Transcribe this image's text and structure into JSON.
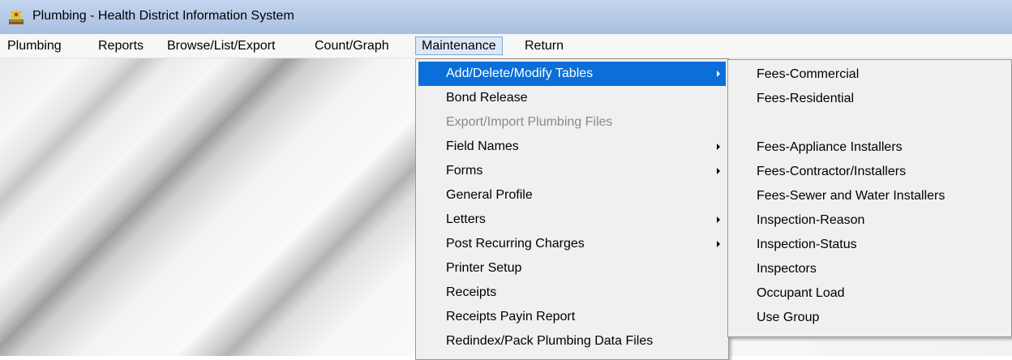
{
  "window": {
    "title": "Plumbing - Health District Information System",
    "icon": "app-flower-icon"
  },
  "menubar": {
    "items": [
      "Plumbing",
      "Reports",
      "Browse/List/Export",
      "Count/Graph",
      "Maintenance",
      "Return"
    ],
    "active": "Maintenance"
  },
  "maintenance_menu": {
    "items": [
      {
        "label": "Add/Delete/Modify Tables",
        "submenu": true,
        "highlighted": true
      },
      {
        "label": "Bond Release"
      },
      {
        "label": "Export/Import Plumbing Files",
        "disabled": true
      },
      {
        "label": "Field Names",
        "submenu": true
      },
      {
        "label": "Forms",
        "submenu": true
      },
      {
        "label": "General Profile"
      },
      {
        "label": "Letters",
        "submenu": true
      },
      {
        "label": "Post Recurring Charges",
        "submenu": true
      },
      {
        "label": "Printer Setup"
      },
      {
        "label": "Receipts"
      },
      {
        "label": "Receipts Payin Report"
      },
      {
        "label": "Redindex/Pack Plumbing Data Files"
      }
    ]
  },
  "tables_submenu": {
    "items": [
      "Fees-Commercial",
      "Fees-Residential",
      "",
      "Fees-Appliance Installers",
      "Fees-Contractor/Installers",
      "Fees-Sewer and Water Installers",
      "Inspection-Reason",
      "Inspection-Status",
      "Inspectors",
      "Occupant Load",
      "Use Group"
    ]
  },
  "colors": {
    "titlebar": "#b4c8e6",
    "menubar": "#f7f7f7",
    "popup": "#f0f0f0",
    "highlight": "#0a6fd8",
    "disabled_text": "#8a8a8a"
  }
}
